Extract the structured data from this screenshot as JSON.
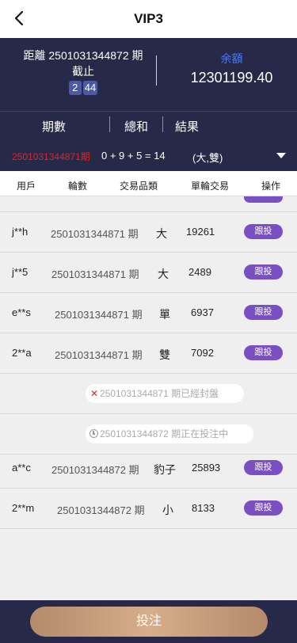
{
  "header": {
    "title": "VIP3"
  },
  "info": {
    "issue_line": "距離 2501031344872 期",
    "close_label": "截止",
    "countdown": [
      "2",
      "44"
    ],
    "balance_label": "余額",
    "balance_value": "12301199.40"
  },
  "result": {
    "headers": [
      "期數",
      "總和",
      "結果"
    ],
    "issue": "2501031344871期",
    "formula": "0 + 9 + 5 = 14",
    "attributes": "(大,雙)"
  },
  "columns": [
    "用戶",
    "輪數",
    "交易品類",
    "單輪交易",
    "操作"
  ],
  "follow_label": "跟投",
  "bets": [
    {
      "user": "j**h",
      "issue": "2501031344871 期",
      "item": "大",
      "amount": "19261"
    },
    {
      "user": "j**5",
      "issue": "2501031344871 期",
      "item": "大",
      "amount": "2489"
    },
    {
      "user": "e**s",
      "issue": "2501031344871 期",
      "item": "單",
      "amount": "6937"
    },
    {
      "user": "2**a",
      "issue": "2501031344871 期",
      "item": "雙",
      "amount": "7092"
    }
  ],
  "notices": {
    "closed": "2501031344871 期已經封盤",
    "open": "2501031344872 期正在投注中"
  },
  "bets_next": [
    {
      "user": "a**c",
      "issue": "2501031344872 期",
      "item": "豹子",
      "amount": "25893"
    },
    {
      "user": "2**m",
      "issue": "2501031344872 期",
      "item": "小",
      "amount": "8133"
    }
  ],
  "footer": {
    "bet_label": "投注"
  },
  "icons": [
    "back-arrow-icon",
    "caret-down-icon",
    "close-x-icon",
    "clock-icon"
  ],
  "colors": {
    "dark_bg": "#262a48",
    "accent_blue": "#4d7bf1",
    "issue_red": "#e52222",
    "follow_purple": "#7a4fc2",
    "bet_gold": "#c9a07e"
  }
}
